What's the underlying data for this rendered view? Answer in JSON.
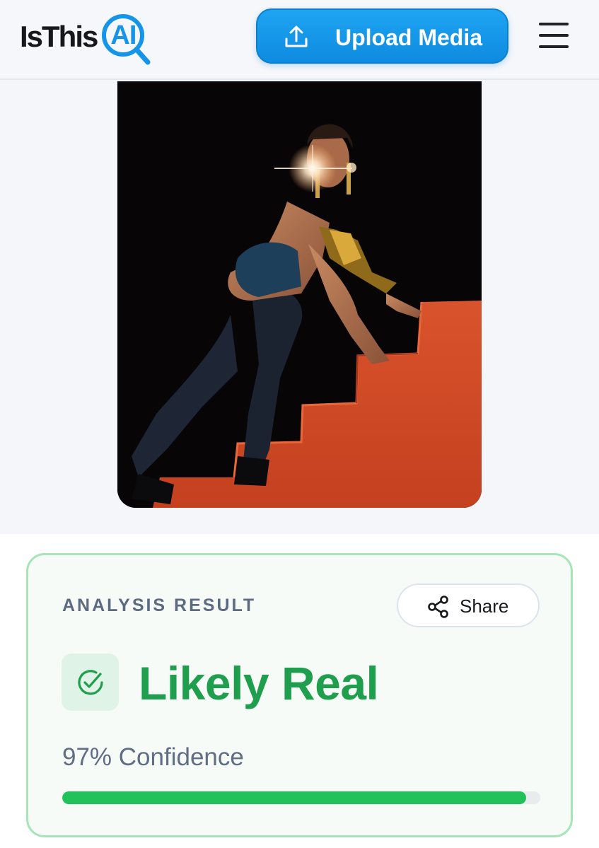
{
  "header": {
    "logo_text": "IsThis",
    "logo_ai": "AI",
    "upload_label": "Upload Media",
    "upload_icon": "upload-icon",
    "menu_icon": "hamburger-menu-icon"
  },
  "result": {
    "heading": "ANALYSIS RESULT",
    "share_label": "Share",
    "share_icon": "share-icon",
    "verdict_icon": "check-circle-icon",
    "verdict": "Likely Real",
    "confidence_text": "97% Confidence",
    "confidence_value": 0.97
  },
  "colors": {
    "brand_blue": "#1595ea",
    "verdict_green": "#1f9e4d",
    "progress_green": "#22c25b",
    "card_border": "#a6e5b7"
  }
}
